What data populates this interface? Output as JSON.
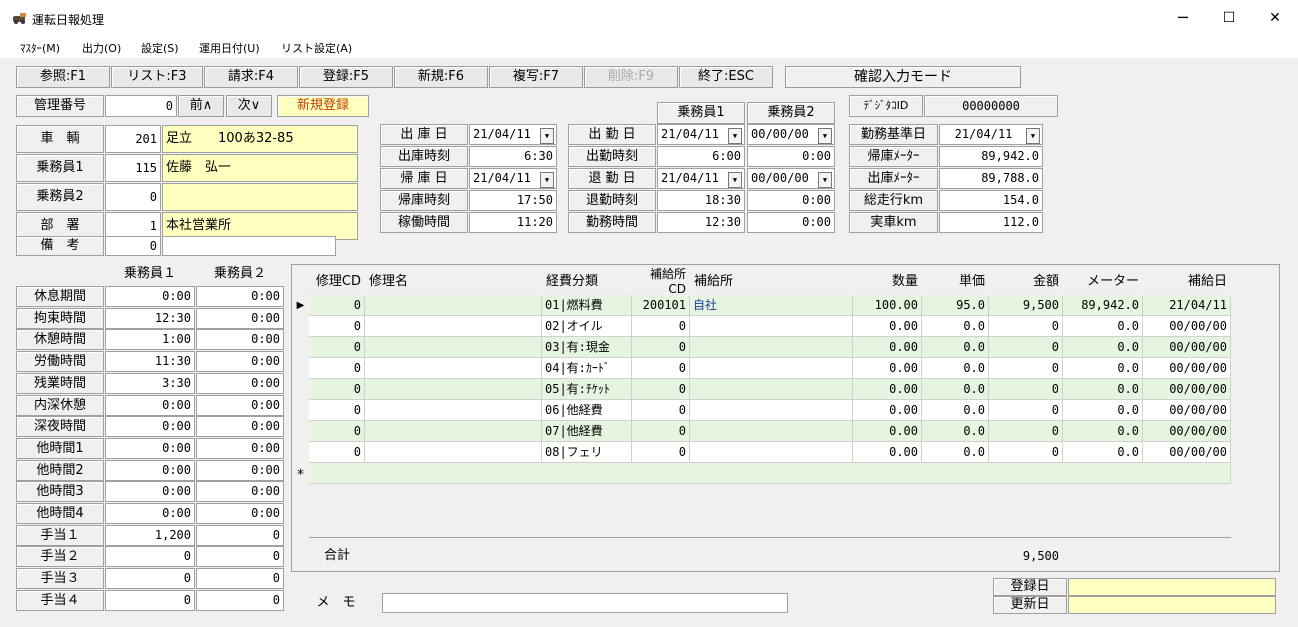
{
  "window": {
    "title": "運転日報処理",
    "minimize": "─",
    "maximize": "☐",
    "close": "✕"
  },
  "menu": [
    "ﾏｽﾀｰ(M)",
    "出力(O)",
    "設定(S)",
    "運用日付(U)",
    "リスト設定(A)"
  ],
  "fkeys": [
    {
      "label": "参照:F1",
      "disabled": false
    },
    {
      "label": "リスト:F3",
      "disabled": false
    },
    {
      "label": "請求:F4",
      "disabled": false
    },
    {
      "label": "登録:F5",
      "disabled": false
    },
    {
      "label": "新規:F6",
      "disabled": false
    },
    {
      "label": "複写:F7",
      "disabled": false
    },
    {
      "label": "削除:F9",
      "disabled": true
    },
    {
      "label": "終了:ESC",
      "disabled": false
    }
  ],
  "mode": "確認入力モード",
  "kanri": {
    "label": "管理番号",
    "value": "0",
    "prev": "前∧",
    "next": "次∨",
    "status": "新規登録"
  },
  "left_fields": [
    {
      "label": "車　輌",
      "code": "201",
      "name": "足立　　100あ32-85"
    },
    {
      "label": "乗務員1",
      "code": "115",
      "name": "佐藤　弘一"
    },
    {
      "label": "乗務員2",
      "code": "0",
      "name": ""
    },
    {
      "label": "部　署",
      "code": "1",
      "name": "本社営業所"
    },
    {
      "label": "備　考",
      "code": "0",
      "name": ""
    }
  ],
  "crew_header": {
    "c1": "乗務員1",
    "c2": "乗務員2"
  },
  "dispatch": [
    {
      "label": "出 庫 日",
      "value": "21/04/11",
      "dd": true
    },
    {
      "label": "出庫時刻",
      "value": "6:30",
      "dd": false
    },
    {
      "label": "帰 庫 日",
      "value": "21/04/11",
      "dd": true
    },
    {
      "label": "帰庫時刻",
      "value": "17:50",
      "dd": false
    },
    {
      "label": "稼働時間",
      "value": "11:20",
      "dd": false
    }
  ],
  "attend": [
    {
      "label": "出 勤 日",
      "v1": "21/04/11",
      "v2": "00/00/00",
      "dd": true
    },
    {
      "label": "出勤時刻",
      "v1": "6:00",
      "v2": "0:00",
      "dd": false
    },
    {
      "label": "退 勤 日",
      "v1": "21/04/11",
      "v2": "00/00/00",
      "dd": true
    },
    {
      "label": "退勤時刻",
      "v1": "18:30",
      "v2": "0:00",
      "dd": false
    },
    {
      "label": "勤務時間",
      "v1": "12:30",
      "v2": "0:00",
      "dd": false
    }
  ],
  "digitaco": {
    "label": "ﾃﾞｼﾞﾀｺID",
    "value": "00000000"
  },
  "meters": [
    {
      "label": "勤務基準日",
      "value": "21/04/11",
      "dd": true
    },
    {
      "label": "帰庫ﾒｰﾀｰ",
      "value": "89,942.0",
      "dd": false
    },
    {
      "label": "出庫ﾒｰﾀｰ",
      "value": "89,788.0",
      "dd": false
    },
    {
      "label": "総走行km",
      "value": "154.0",
      "dd": false
    },
    {
      "label": "実車km",
      "value": "112.0",
      "dd": false
    }
  ],
  "times_header": {
    "c1": "乗務員１",
    "c2": "乗務員２"
  },
  "times": [
    {
      "label": "休息期間",
      "v1": "0:00",
      "v2": "0:00"
    },
    {
      "label": "拘束時間",
      "v1": "12:30",
      "v2": "0:00"
    },
    {
      "label": "休憩時間",
      "v1": "1:00",
      "v2": "0:00"
    },
    {
      "label": "労働時間",
      "v1": "11:30",
      "v2": "0:00"
    },
    {
      "label": "残業時間",
      "v1": "3:30",
      "v2": "0:00"
    },
    {
      "label": "内深休憩",
      "v1": "0:00",
      "v2": "0:00"
    },
    {
      "label": "深夜時間",
      "v1": "0:00",
      "v2": "0:00"
    },
    {
      "label": "他時間1",
      "v1": "0:00",
      "v2": "0:00"
    },
    {
      "label": "他時間2",
      "v1": "0:00",
      "v2": "0:00"
    },
    {
      "label": "他時間3",
      "v1": "0:00",
      "v2": "0:00"
    },
    {
      "label": "他時間4",
      "v1": "0:00",
      "v2": "0:00"
    },
    {
      "label": "手当１",
      "v1": "1,200",
      "v2": "0"
    },
    {
      "label": "手当２",
      "v1": "0",
      "v2": "0"
    },
    {
      "label": "手当３",
      "v1": "0",
      "v2": "0"
    },
    {
      "label": "手当４",
      "v1": "0",
      "v2": "0"
    }
  ],
  "grid": {
    "columns": [
      "修理CD",
      "修理名",
      "経費分類",
      "補給所CD",
      "補給所",
      "数量",
      "単価",
      "金額",
      "メーター",
      "補給日"
    ],
    "rows": [
      [
        "0",
        "",
        "01|燃料費",
        "200101",
        "自社",
        "100.00",
        "95.0",
        "9,500",
        "89,942.0",
        "21/04/11"
      ],
      [
        "0",
        "",
        "02|オイル",
        "0",
        "",
        "0.00",
        "0.0",
        "0",
        "0.0",
        "00/00/00"
      ],
      [
        "0",
        "",
        "03|有:現金",
        "0",
        "",
        "0.00",
        "0.0",
        "0",
        "0.0",
        "00/00/00"
      ],
      [
        "0",
        "",
        "04|有:ｶｰﾄﾞ",
        "0",
        "",
        "0.00",
        "0.0",
        "0",
        "0.0",
        "00/00/00"
      ],
      [
        "0",
        "",
        "05|有:ﾁｹｯﾄ",
        "0",
        "",
        "0.00",
        "0.0",
        "0",
        "0.0",
        "00/00/00"
      ],
      [
        "0",
        "",
        "06|他経費",
        "0",
        "",
        "0.00",
        "0.0",
        "0",
        "0.0",
        "00/00/00"
      ],
      [
        "0",
        "",
        "07|他経費",
        "0",
        "",
        "0.00",
        "0.0",
        "0",
        "0.0",
        "00/00/00"
      ],
      [
        "0",
        "",
        "08|フェリ",
        "0",
        "",
        "0.00",
        "0.0",
        "0",
        "0.0",
        "00/00/00"
      ]
    ],
    "row_marker": "▶",
    "new_marker": "*",
    "total_label": "合計",
    "total_amount": "9,500"
  },
  "memo": {
    "label": "メ　モ",
    "value": ""
  },
  "reg": {
    "created": "登録日",
    "updated": "更新日"
  }
}
